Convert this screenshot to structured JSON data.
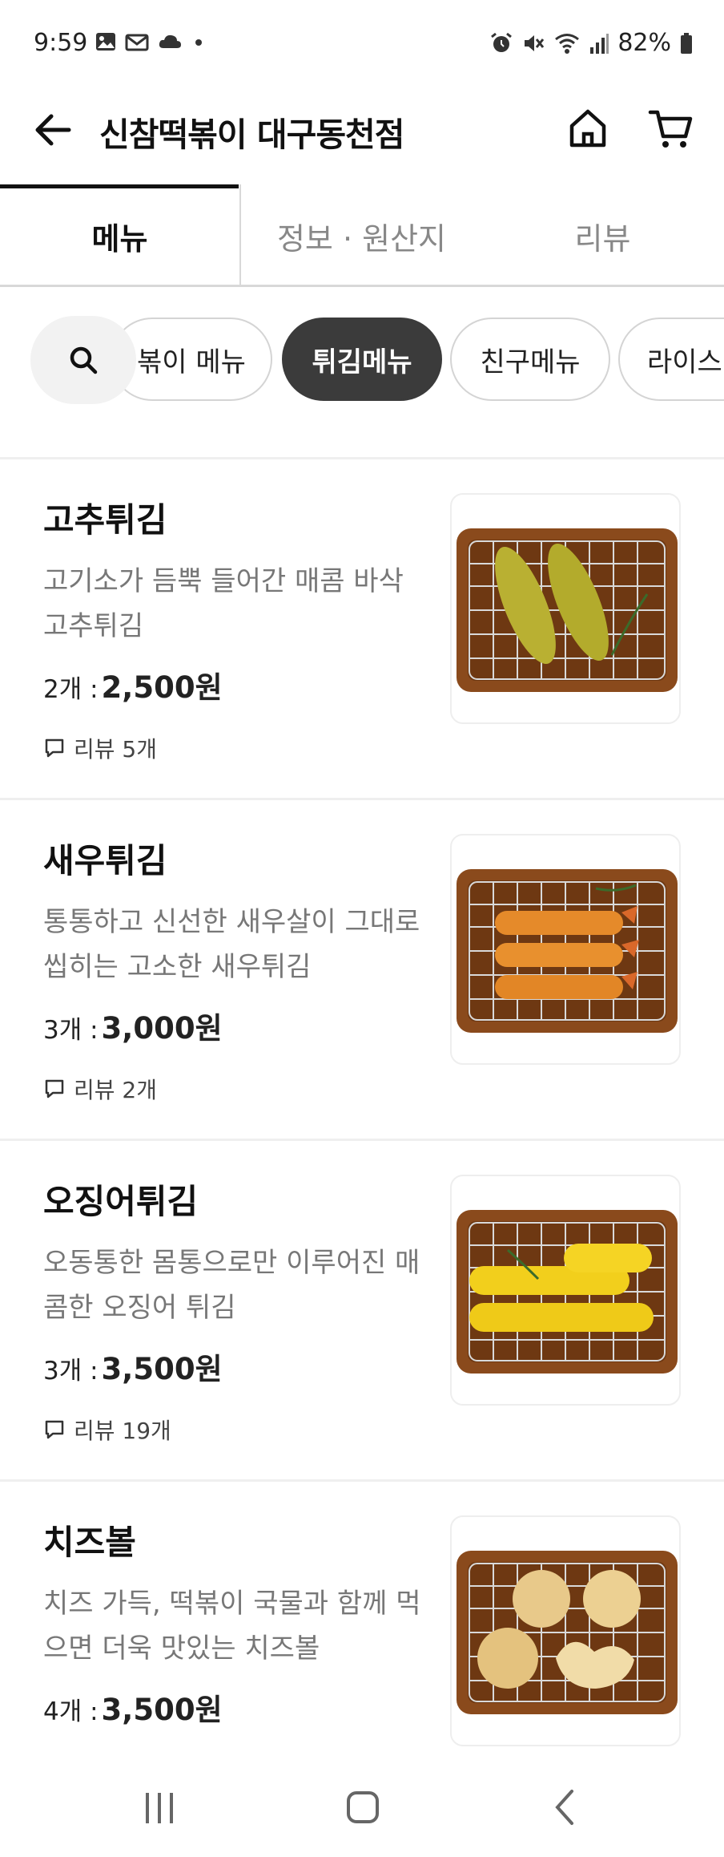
{
  "status_bar": {
    "time": "9:59",
    "battery": "82%",
    "left_icons": [
      "image-icon",
      "mail-icon",
      "cloud-icon",
      "dot-icon"
    ],
    "right_icons": [
      "alarm-icon",
      "mute-icon",
      "wifi-icon",
      "signal-icon",
      "battery-icon"
    ]
  },
  "header": {
    "title": "신참떡볶이 대구동천점",
    "icons": [
      "back-arrow-icon",
      "home-icon",
      "cart-icon"
    ]
  },
  "tabs": [
    {
      "label": "메뉴",
      "active": true
    },
    {
      "label": "정보 · 원산지",
      "active": false
    },
    {
      "label": "리뷰",
      "active": false
    }
  ],
  "categories": [
    {
      "label": "볶이 메뉴",
      "selected": false
    },
    {
      "label": "튀김메뉴",
      "selected": true
    },
    {
      "label": "친구메뉴",
      "selected": false
    },
    {
      "label": "라이스",
      "selected": false
    }
  ],
  "items": [
    {
      "name": "고추튀김",
      "desc": "고기소가 듬뿍 들어간 매콤 바삭 고추튀김",
      "qty": "2개 :",
      "price": "2,500원",
      "review": "리뷰 5개",
      "image": "fried-pepper"
    },
    {
      "name": "새우튀김",
      "desc": "통통하고 신선한 새우살이 그대로 씹히는 고소한 새우튀김",
      "qty": "3개 :",
      "price": "3,000원",
      "review": "리뷰 2개",
      "image": "fried-shrimp"
    },
    {
      "name": "오징어튀김",
      "desc": "오동통한 몸통으로만 이루어진 매콤한 오징어 튀김",
      "qty": "3개 :",
      "price": "3,500원",
      "review": "리뷰 19개",
      "image": "fried-squid"
    },
    {
      "name": "치즈볼",
      "desc": "치즈 가득, 떡볶이 국물과 함께 먹으면 더욱 맛있는 치즈볼",
      "qty": "4개 :",
      "price": "3,500원",
      "review": "",
      "image": "cheese-ball"
    }
  ],
  "colors": {
    "chip_selected_bg": "#3b3b3b",
    "tray_wood": "#8a4a1c",
    "text_primary": "#111111",
    "text_secondary": "#777777"
  },
  "nav": [
    "recents-icon",
    "home-nav-icon",
    "back-nav-icon"
  ]
}
